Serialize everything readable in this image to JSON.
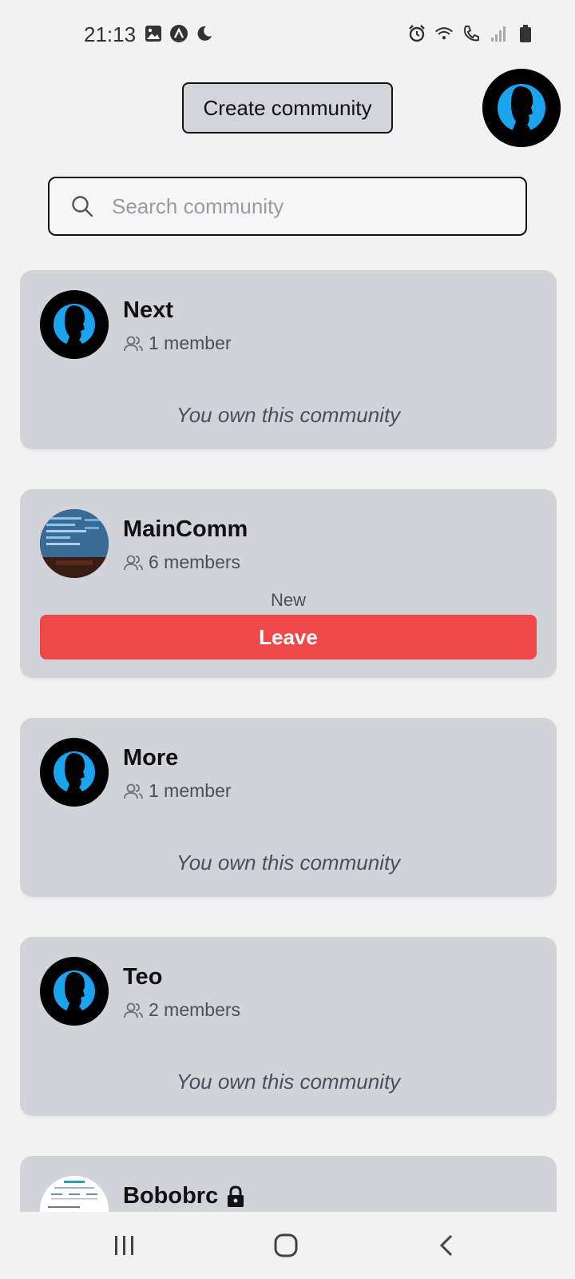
{
  "status_bar": {
    "time": "21:13",
    "left_icons": [
      "gallery-icon",
      "app-a-icon",
      "moon-icon"
    ],
    "right_icons": [
      "alarm-icon",
      "wifi-icon",
      "call-icon",
      "signal-icon",
      "battery-icon"
    ]
  },
  "header": {
    "create_label": "Create community",
    "profile_icon": "avatar-silhouette"
  },
  "search": {
    "placeholder": "Search community",
    "value": ""
  },
  "communities": [
    {
      "name": "Next",
      "members": "1 member",
      "note": "You own this community",
      "avatar": "silhouette"
    },
    {
      "name": "MainComm",
      "members": "6 members",
      "note": "New",
      "action": "Leave",
      "avatar": "code-photo"
    },
    {
      "name": "More",
      "members": "1 member",
      "note": "You own this community",
      "avatar": "silhouette"
    },
    {
      "name": "Teo",
      "members": "2 members",
      "note": "You own this community",
      "avatar": "silhouette"
    },
    {
      "name": "Bobobrc",
      "locked": true,
      "avatar": "document-thumbnail"
    }
  ],
  "nav": [
    "recent-apps-icon",
    "home-icon",
    "back-icon"
  ],
  "colors": {
    "background": "#f2f2f3",
    "card": "#d2d3d9",
    "leave": "#ef4848",
    "avatar_blue": "#1aa3ef"
  }
}
